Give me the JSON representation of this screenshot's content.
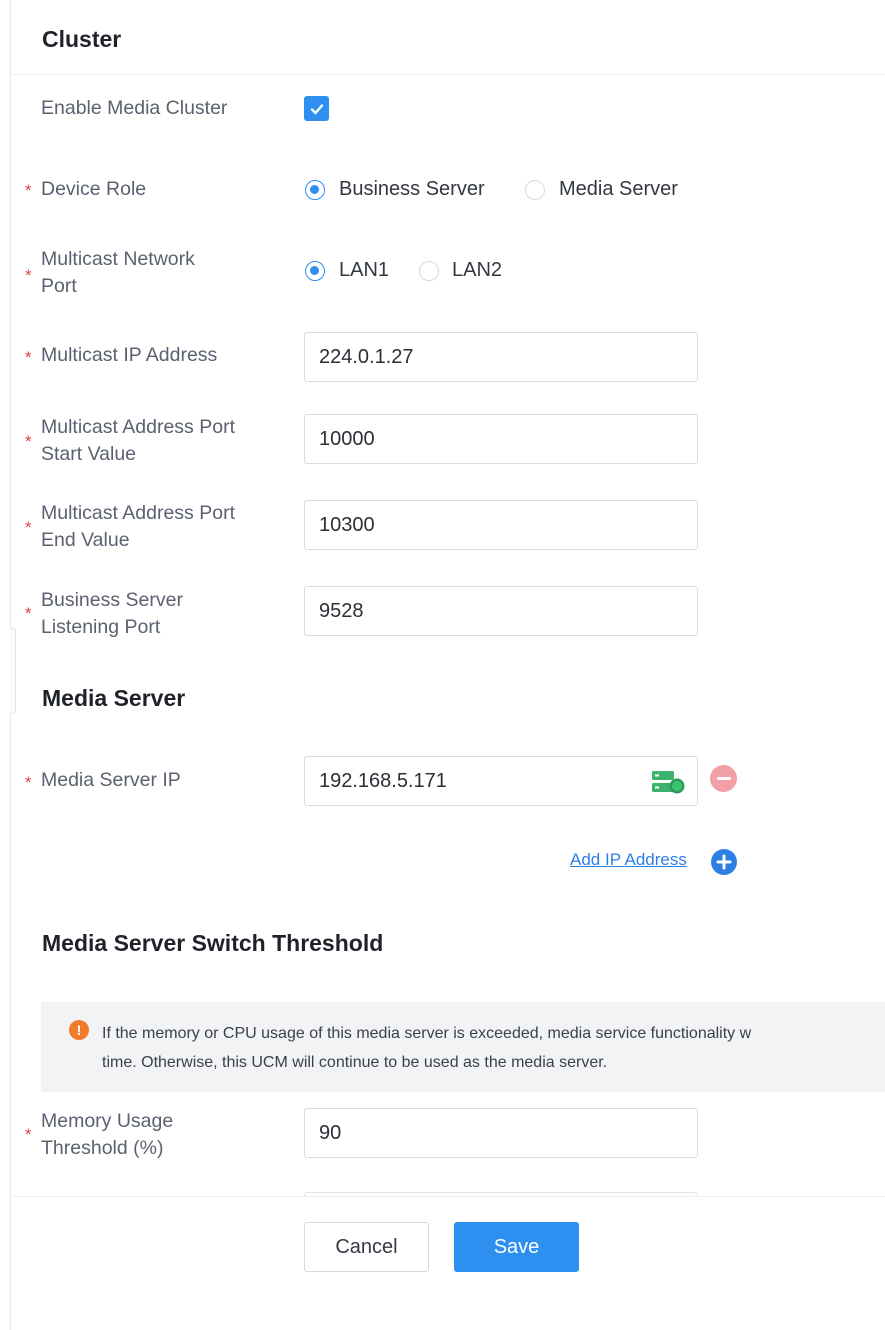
{
  "cluster": {
    "title": "Cluster",
    "enable_label": "Enable Media Cluster",
    "enable_checked": true,
    "device_role": {
      "label": "Device Role",
      "options": [
        "Business Server",
        "Media Server"
      ],
      "selected": "Business Server"
    },
    "multicast_port": {
      "label_line1": "Multicast Network",
      "label_line2": "Port",
      "options": [
        "LAN1",
        "LAN2"
      ],
      "selected": "LAN1"
    },
    "multicast_ip": {
      "label": "Multicast IP Address",
      "value": "224.0.1.27"
    },
    "port_start": {
      "label_line1": "Multicast Address Port",
      "label_line2": "Start Value",
      "value": "10000"
    },
    "port_end": {
      "label_line1": "Multicast Address Port",
      "label_line2": "End Value",
      "value": "10300"
    },
    "listening_port": {
      "label_line1": "Business Server",
      "label_line2": "Listening Port",
      "value": "9528"
    }
  },
  "media_server": {
    "title": "Media Server",
    "ip_label": "Media Server IP",
    "ip_value": "192.168.5.171",
    "add_link": "Add IP Address"
  },
  "threshold": {
    "title": "Media Server Switch Threshold",
    "notice_line1": "If the memory or CPU usage of this media server is exceeded, media service functionality w",
    "notice_line2": "time. Otherwise, this UCM will continue to be used as the media server.",
    "memory": {
      "label_line1": "Memory Usage",
      "label_line2": "Threshold (%)",
      "value": "90"
    }
  },
  "footer": {
    "cancel_label": "Cancel",
    "save_label": "Save"
  },
  "colors": {
    "accent": "#2d8ff0",
    "required": "#e0424b",
    "remove": "#f2a0a5",
    "server_icon": "#3cb46e",
    "warning": "#f07b2c"
  }
}
